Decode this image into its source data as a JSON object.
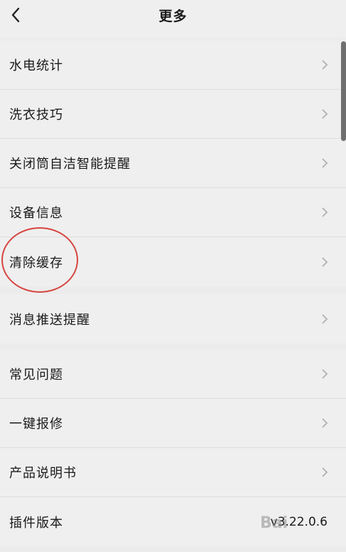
{
  "header": {
    "title": "更多",
    "back_icon": "chevron-left-icon"
  },
  "group1": {
    "items": [
      {
        "label": "水电统计"
      },
      {
        "label": "洗衣技巧"
      },
      {
        "label": "关闭筒自洁智能提醒"
      },
      {
        "label": "设备信息"
      },
      {
        "label": "清除缓存"
      }
    ]
  },
  "group2": {
    "items": [
      {
        "label": "消息推送提醒"
      }
    ]
  },
  "group3": {
    "items": [
      {
        "label": "常见问题"
      },
      {
        "label": "一键报修"
      },
      {
        "label": "产品说明书"
      }
    ],
    "version": {
      "label": "插件版本",
      "value": "v3.22.0.6"
    }
  },
  "overlay": {
    "watermark": "Bai",
    "circle_color": "#d6453f"
  },
  "colors": {
    "background": "#efefef",
    "separator": "#e6e6e6",
    "chevron": "#b0b0b0"
  }
}
